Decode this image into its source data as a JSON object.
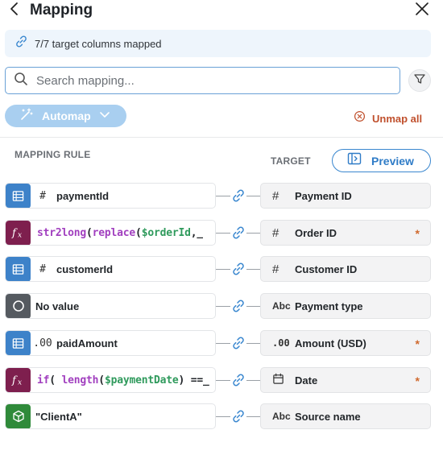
{
  "header": {
    "title": "Mapping",
    "back_icon": "chevron-left-icon",
    "close_icon": "close-icon"
  },
  "status_banner": {
    "icon": "link-icon",
    "text": "7/7 target columns mapped"
  },
  "search": {
    "placeholder": "Search mapping...",
    "value": ""
  },
  "toolbar": {
    "automap_label": "Automap",
    "unmap_all_label": "Unmap all",
    "preview_label": "Preview"
  },
  "columns": {
    "source_header": "MAPPING RULE",
    "target_header": "TARGET"
  },
  "mappings": [
    {
      "source_kind": "column",
      "source_type": "#",
      "source_name": "paymentId",
      "target_type": "#",
      "target_name": "Payment ID",
      "required": false
    },
    {
      "source_kind": "function",
      "expression": [
        {
          "cls": "fn",
          "t": "str2long"
        },
        {
          "cls": "pn",
          "t": "("
        },
        {
          "cls": "fn",
          "t": "replace"
        },
        {
          "cls": "pn",
          "t": "("
        },
        {
          "cls": "vr",
          "t": "$orderId"
        },
        {
          "cls": "pn",
          "t": ",_"
        }
      ],
      "target_type": "#",
      "target_name": "Order ID",
      "required": true
    },
    {
      "source_kind": "column",
      "source_type": "#",
      "source_name": "customerId",
      "target_type": "#",
      "target_name": "Customer ID",
      "required": false
    },
    {
      "source_kind": "none",
      "source_name": "No value",
      "target_type": "Abc",
      "target_name": "Payment type",
      "required": false
    },
    {
      "source_kind": "column",
      "source_type": ".00",
      "source_name": "paidAmount",
      "target_type": ".00",
      "target_name": "Amount (USD)",
      "required": true
    },
    {
      "source_kind": "function",
      "expression": [
        {
          "cls": "fn",
          "t": "if"
        },
        {
          "cls": "pn",
          "t": "( "
        },
        {
          "cls": "fn",
          "t": "length"
        },
        {
          "cls": "pn",
          "t": "("
        },
        {
          "cls": "vr",
          "t": "$paymentDate"
        },
        {
          "cls": "pn",
          "t": ") ==_"
        }
      ],
      "target_type": "calendar",
      "target_name": "Date",
      "required": true
    },
    {
      "source_kind": "constant",
      "source_name": "\"ClientA\"",
      "target_type": "Abc",
      "target_name": "Source name",
      "required": false
    }
  ],
  "required_marker": "*",
  "colors": {
    "accent": "#2f7cc7",
    "column_badge": "#3d82c9",
    "function_badge": "#7e1f4e",
    "none_badge": "#555a60",
    "constant_badge": "#2f8a3a",
    "unmap": "#c0502d",
    "required": "#d06a2f"
  }
}
